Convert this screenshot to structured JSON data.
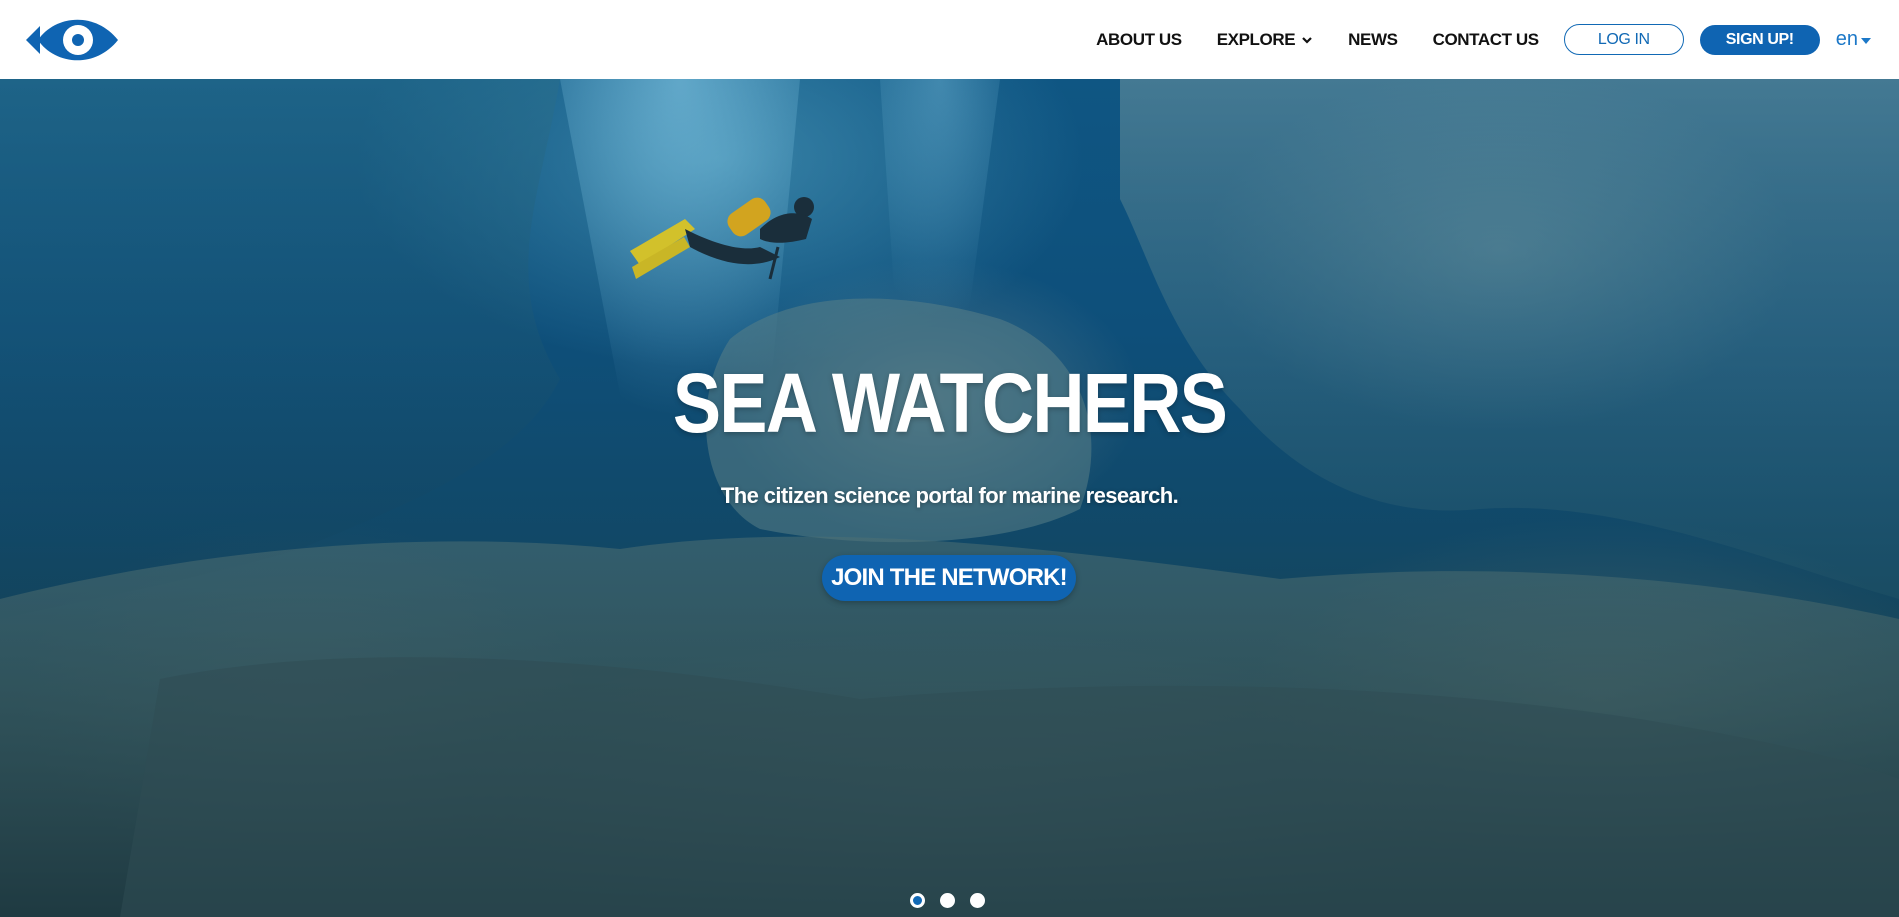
{
  "brand": {
    "logo_icon": "fish-eye-icon",
    "primary_color": "#0f64b2",
    "accent_color": "#1c78c8"
  },
  "nav": {
    "items": [
      {
        "label": "ABOUT US"
      },
      {
        "label": "EXPLORE",
        "has_dropdown": true,
        "icon": "chevron-down-icon"
      },
      {
        "label": "NEWS"
      },
      {
        "label": "CONTACT US"
      }
    ],
    "login_label": "LOG IN",
    "signup_label": "SIGN UP!",
    "language": "en",
    "language_icon": "caret-down-icon"
  },
  "hero": {
    "title": "SEA WATCHERS",
    "subtitle": "The citizen science portal for marine research.",
    "cta_label": "JOIN THE NETWORK!",
    "background": "underwater-diver-seagrass-photo"
  },
  "carousel": {
    "slide_count": 3,
    "active_index": 0
  }
}
